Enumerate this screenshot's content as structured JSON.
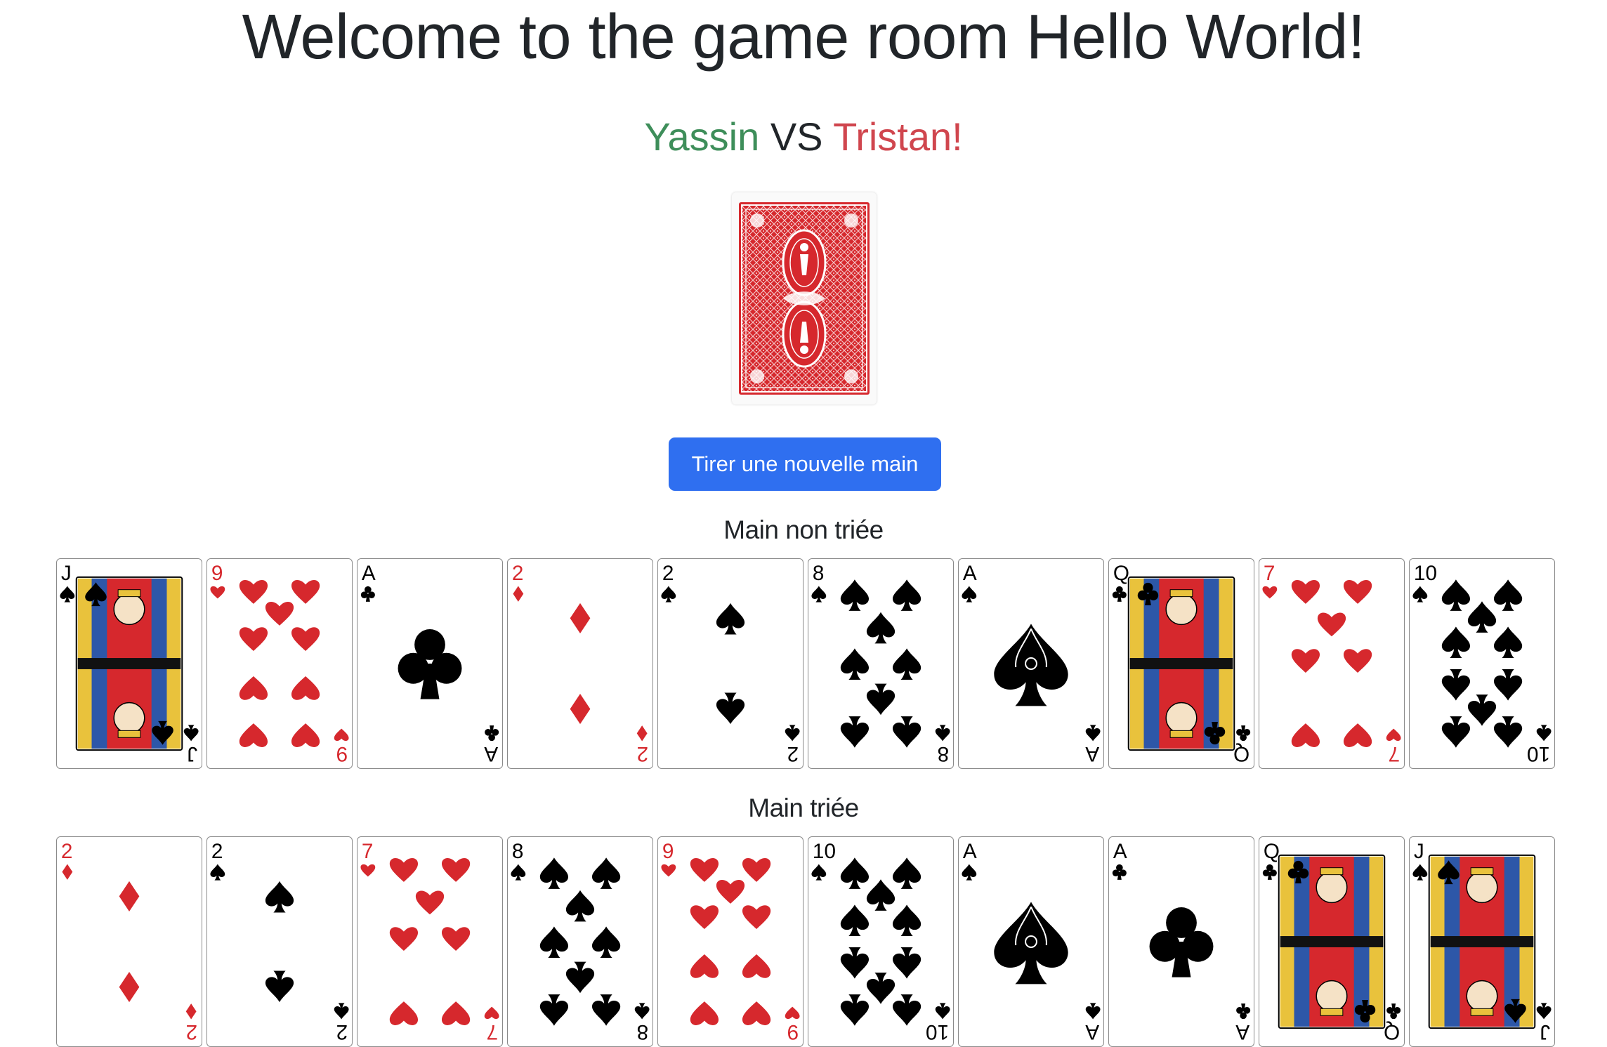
{
  "header": {
    "title": "Welcome to the game room Hello World!"
  },
  "players": {
    "player1": "Yassin",
    "vs": "VS",
    "player2": "Tristan!"
  },
  "deck": {
    "icon": "card-back-icon",
    "color": "#d6282d"
  },
  "actions": {
    "draw_label": "Tirer une nouvelle main",
    "draw_color": "#2f6ff0"
  },
  "colors": {
    "red": "#d6282d",
    "black": "#000000",
    "player1": "#3e8e5a",
    "player2": "#d0464e"
  },
  "unsorted": {
    "label": "Main non triée",
    "cards": [
      {
        "rank": "J",
        "suit": "spades"
      },
      {
        "rank": "9",
        "suit": "hearts"
      },
      {
        "rank": "A",
        "suit": "clubs"
      },
      {
        "rank": "2",
        "suit": "diamonds"
      },
      {
        "rank": "2",
        "suit": "spades"
      },
      {
        "rank": "8",
        "suit": "spades"
      },
      {
        "rank": "A",
        "suit": "spades"
      },
      {
        "rank": "Q",
        "suit": "clubs"
      },
      {
        "rank": "7",
        "suit": "hearts"
      },
      {
        "rank": "10",
        "suit": "spades"
      }
    ]
  },
  "sorted": {
    "label": "Main triée",
    "cards": [
      {
        "rank": "2",
        "suit": "diamonds"
      },
      {
        "rank": "2",
        "suit": "spades"
      },
      {
        "rank": "7",
        "suit": "hearts"
      },
      {
        "rank": "8",
        "suit": "spades"
      },
      {
        "rank": "9",
        "suit": "hearts"
      },
      {
        "rank": "10",
        "suit": "spades"
      },
      {
        "rank": "A",
        "suit": "spades"
      },
      {
        "rank": "A",
        "suit": "clubs"
      },
      {
        "rank": "Q",
        "suit": "clubs"
      },
      {
        "rank": "J",
        "suit": "spades"
      }
    ]
  }
}
